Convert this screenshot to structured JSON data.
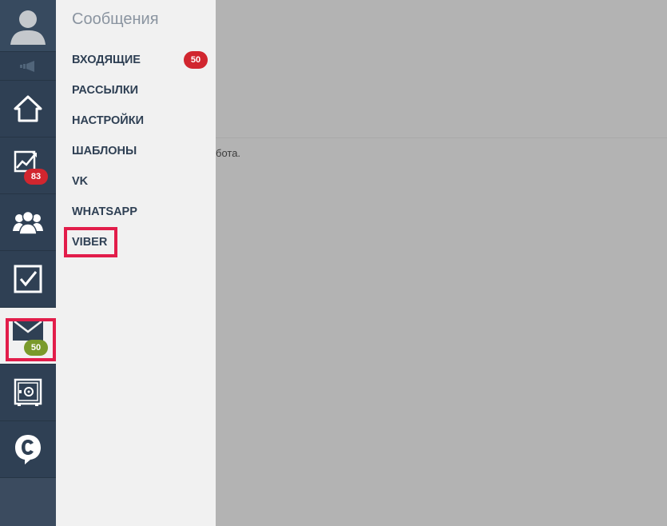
{
  "rail": {
    "analytics_badge": "83",
    "messages_badge": "50"
  },
  "submenu": {
    "title": "Сообщения",
    "inbox_badge": "50",
    "items": [
      {
        "label": "ВХОДЯЩИЕ"
      },
      {
        "label": "РАССЫЛКИ"
      },
      {
        "label": "НАСТРОЙКИ"
      },
      {
        "label": "ШАБЛОНЫ"
      },
      {
        "label": "VK"
      },
      {
        "label": "WHATSAPP"
      },
      {
        "label": "VIBER"
      }
    ]
  },
  "content": {
    "text_fragment": "бота."
  },
  "colors": {
    "rail_bg": "#2f4054",
    "submenu_bg": "#f1f1f1",
    "overlay": "#b3b3b3",
    "badge_red": "#d1262f",
    "badge_green": "#7a9a2b",
    "highlight": "#e21d4a"
  },
  "icons": [
    "user-avatar-icon",
    "megaphone-icon",
    "home-icon",
    "analytics-icon",
    "clients-icon",
    "tasks-checkbox-icon",
    "mail-icon",
    "safe-icon",
    "chat-c-icon"
  ]
}
